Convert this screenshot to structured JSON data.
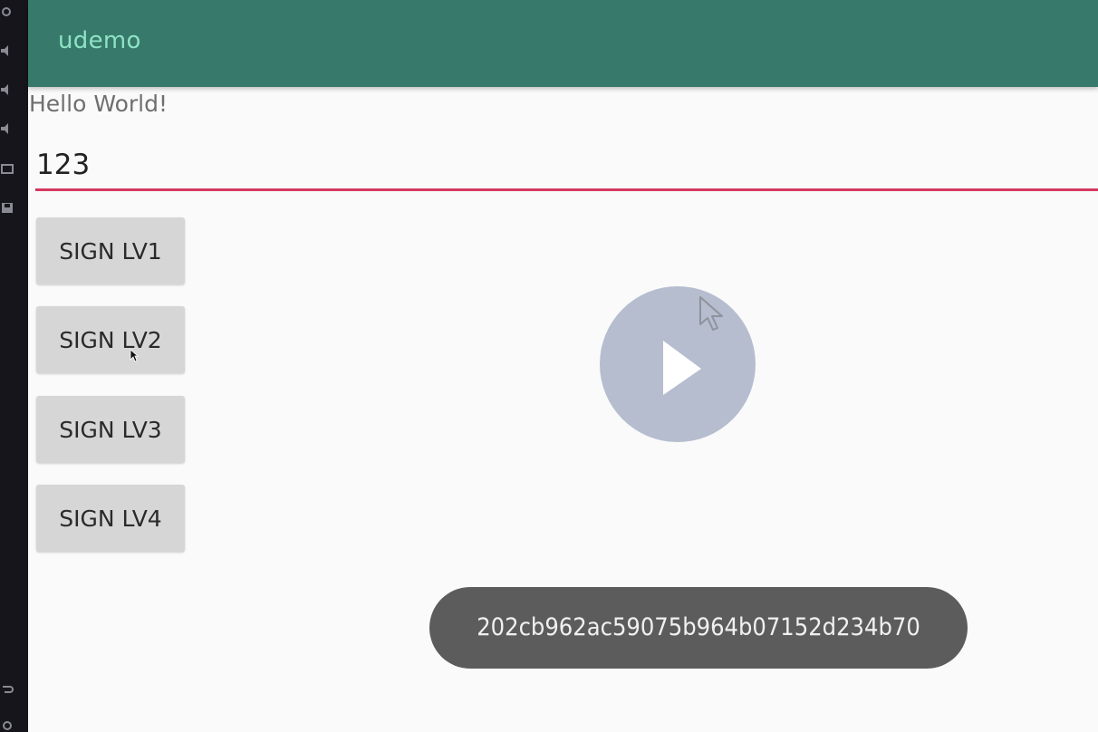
{
  "ide_strip": {
    "icons": [
      "gear-icon",
      "speaker-icon",
      "speaker-icon",
      "speaker-icon",
      "bag-icon",
      "save-icon",
      "undo-icon",
      "redo-icon"
    ]
  },
  "toolbar": {
    "title": "udemo",
    "background_color": "#37796a",
    "title_color": "#8de3c4"
  },
  "main": {
    "hello_text": "Hello World!",
    "input_value": "123",
    "input_underline_color": "#d23a5f",
    "buttons": [
      {
        "label": "SIGN LV1"
      },
      {
        "label": "SIGN LV2"
      },
      {
        "label": "SIGN LV3"
      },
      {
        "label": "SIGN LV4"
      }
    ]
  },
  "overlay": {
    "play_icon": "play-icon"
  },
  "toast": {
    "text": "202cb962ac59075b964b07152d234b70"
  }
}
